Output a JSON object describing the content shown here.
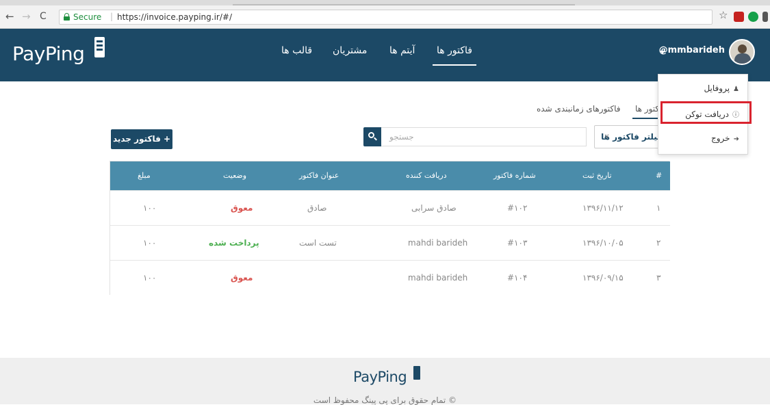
{
  "browser": {
    "secure_label": "Secure",
    "url": "https://invoice.payping.ir/#/",
    "back": "←",
    "forward": "→",
    "reload": "C",
    "star": "☆"
  },
  "header": {
    "logo": "PayPing",
    "nav": {
      "invoices": "فاکتور ها",
      "items": "آیتم ها",
      "customers": "مشتریان",
      "templates": "قالب ها"
    },
    "username": "@mmbarideh"
  },
  "dropdown": {
    "profile": "پروفایل",
    "get_token": "دریافت توکن",
    "logout": "خروج"
  },
  "tabs": {
    "invoices": "فاکتور ها",
    "scheduled": "فاکتورهای زمانبندی شده"
  },
  "toolbar": {
    "new_invoice": "+ فاکتور جدید",
    "search_placeholder": "جستجو",
    "filter_label": "فیلتر فاکتور ها"
  },
  "table": {
    "headers": [
      "#",
      "تاریخ ثبت",
      "شماره فاکتور",
      "دریافت کننده",
      "عنوان فاکتور",
      "وضعیت",
      "مبلغ"
    ],
    "rows": [
      {
        "num": "۱",
        "date": "۱۳۹۶/۱۱/۱۲",
        "invoice": "#۱۰۲",
        "recipient": "صادق سرابی",
        "title": "صادق",
        "status": "معوق",
        "amount": "۱۰۰"
      },
      {
        "num": "۲",
        "date": "۱۳۹۶/۱۰/۰۵",
        "invoice": "#۱۰۳",
        "recipient": "mahdi barideh",
        "title": "تست است",
        "status": "پرداخت شده",
        "amount": "۱۰۰"
      },
      {
        "num": "۳",
        "date": "۱۳۹۶/۰۹/۱۵",
        "invoice": "#۱۰۴",
        "recipient": "mahdi barideh",
        "title": "",
        "status": "معوق",
        "amount": "۱۰۰"
      }
    ]
  },
  "footer": {
    "logo": "PayPing",
    "copyright": "© تمام حقوق برای پی پینگ محفوظ است"
  },
  "colors": {
    "header_bg": "#1c4966",
    "table_header_bg": "#4a8caa",
    "late": "#d9534f",
    "paid": "#4caf50",
    "highlight": "#d9232e"
  }
}
